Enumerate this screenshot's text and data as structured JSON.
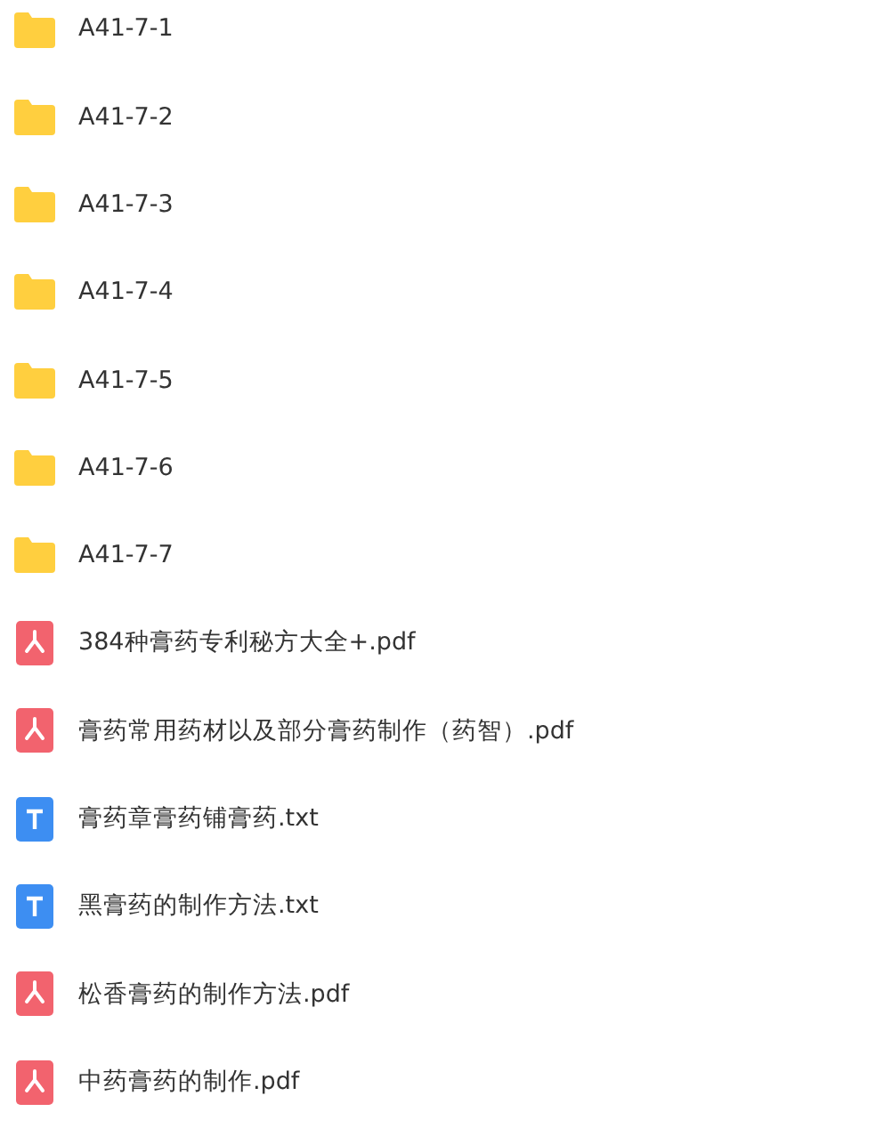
{
  "files": [
    {
      "kind": "folder",
      "name": "A41-7-1"
    },
    {
      "kind": "folder",
      "name": "A41-7-2"
    },
    {
      "kind": "folder",
      "name": "A41-7-3"
    },
    {
      "kind": "folder",
      "name": "A41-7-4"
    },
    {
      "kind": "folder",
      "name": "A41-7-5"
    },
    {
      "kind": "folder",
      "name": "A41-7-6"
    },
    {
      "kind": "folder",
      "name": "A41-7-7"
    },
    {
      "kind": "pdf",
      "name": "384种膏药专利秘方大全+.pdf"
    },
    {
      "kind": "pdf",
      "name": "膏药常用药材以及部分膏药制作（药智）.pdf"
    },
    {
      "kind": "txt",
      "name": "膏药章膏药铺膏药.txt"
    },
    {
      "kind": "txt",
      "name": "黑膏药的制作方法.txt"
    },
    {
      "kind": "pdf",
      "name": "松香膏药的制作方法.pdf"
    },
    {
      "kind": "pdf",
      "name": "中药膏药的制作.pdf"
    }
  ]
}
